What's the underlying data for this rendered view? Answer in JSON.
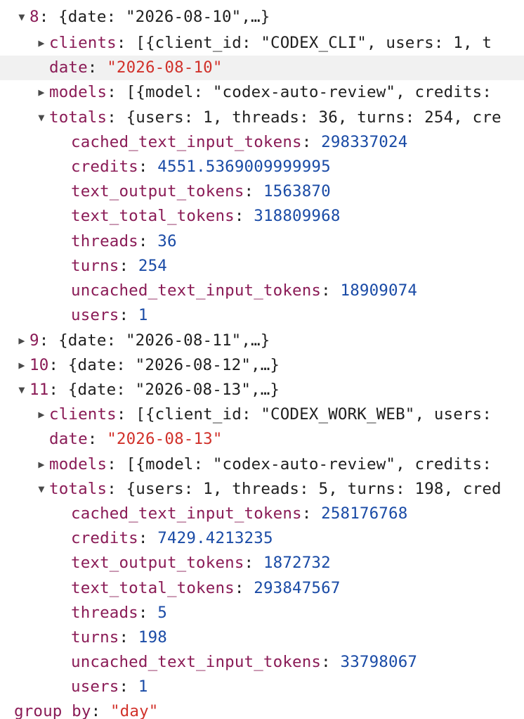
{
  "entry8": {
    "index": "8",
    "summary": "{date: \"2026-08-10\",…}",
    "clients_key": "clients",
    "clients_preview": "[{client_id: \"CODEX_CLI\", users: 1, t",
    "date_key": "date",
    "date_value": "\"2026-08-10\"",
    "models_key": "models",
    "models_preview": "[{model: \"codex-auto-review\", credits:",
    "totals_key": "totals",
    "totals_preview": "{users: 1, threads: 36, turns: 254, cre",
    "totals": [
      {
        "key": "cached_text_input_tokens",
        "value": "298337024"
      },
      {
        "key": "credits",
        "value": "4551.5369009999995"
      },
      {
        "key": "text_output_tokens",
        "value": "1563870"
      },
      {
        "key": "text_total_tokens",
        "value": "318809968"
      },
      {
        "key": "threads",
        "value": "36"
      },
      {
        "key": "turns",
        "value": "254"
      },
      {
        "key": "uncached_text_input_tokens",
        "value": "18909074"
      },
      {
        "key": "users",
        "value": "1"
      }
    ]
  },
  "entry9": {
    "index": "9",
    "summary": "{date: \"2026-08-11\",…}"
  },
  "entry10": {
    "index": "10",
    "summary": "{date: \"2026-08-12\",…}"
  },
  "entry11": {
    "index": "11",
    "summary": "{date: \"2026-08-13\",…}",
    "clients_key": "clients",
    "clients_preview": "[{client_id: \"CODEX_WORK_WEB\", users:",
    "date_key": "date",
    "date_value": "\"2026-08-13\"",
    "models_key": "models",
    "models_preview": "[{model: \"codex-auto-review\", credits:",
    "totals_key": "totals",
    "totals_preview": "{users: 1, threads: 5, turns: 198, cred",
    "totals": [
      {
        "key": "cached_text_input_tokens",
        "value": "258176768"
      },
      {
        "key": "credits",
        "value": "7429.4213235"
      },
      {
        "key": "text_output_tokens",
        "value": "1872732"
      },
      {
        "key": "text_total_tokens",
        "value": "293847567"
      },
      {
        "key": "threads",
        "value": "5"
      },
      {
        "key": "turns",
        "value": "198"
      },
      {
        "key": "uncached_text_input_tokens",
        "value": "33798067"
      },
      {
        "key": "users",
        "value": "1"
      }
    ]
  },
  "group_by": {
    "key": "group_by",
    "value": "\"day\""
  },
  "glyphs": {
    "expanded": "▼",
    "collapsed": "▶",
    "colon": ": "
  },
  "colors": {
    "key": "#8a1b56",
    "number": "#1a4ba6",
    "string": "#d1312a",
    "highlight": "#f1f1f1"
  }
}
